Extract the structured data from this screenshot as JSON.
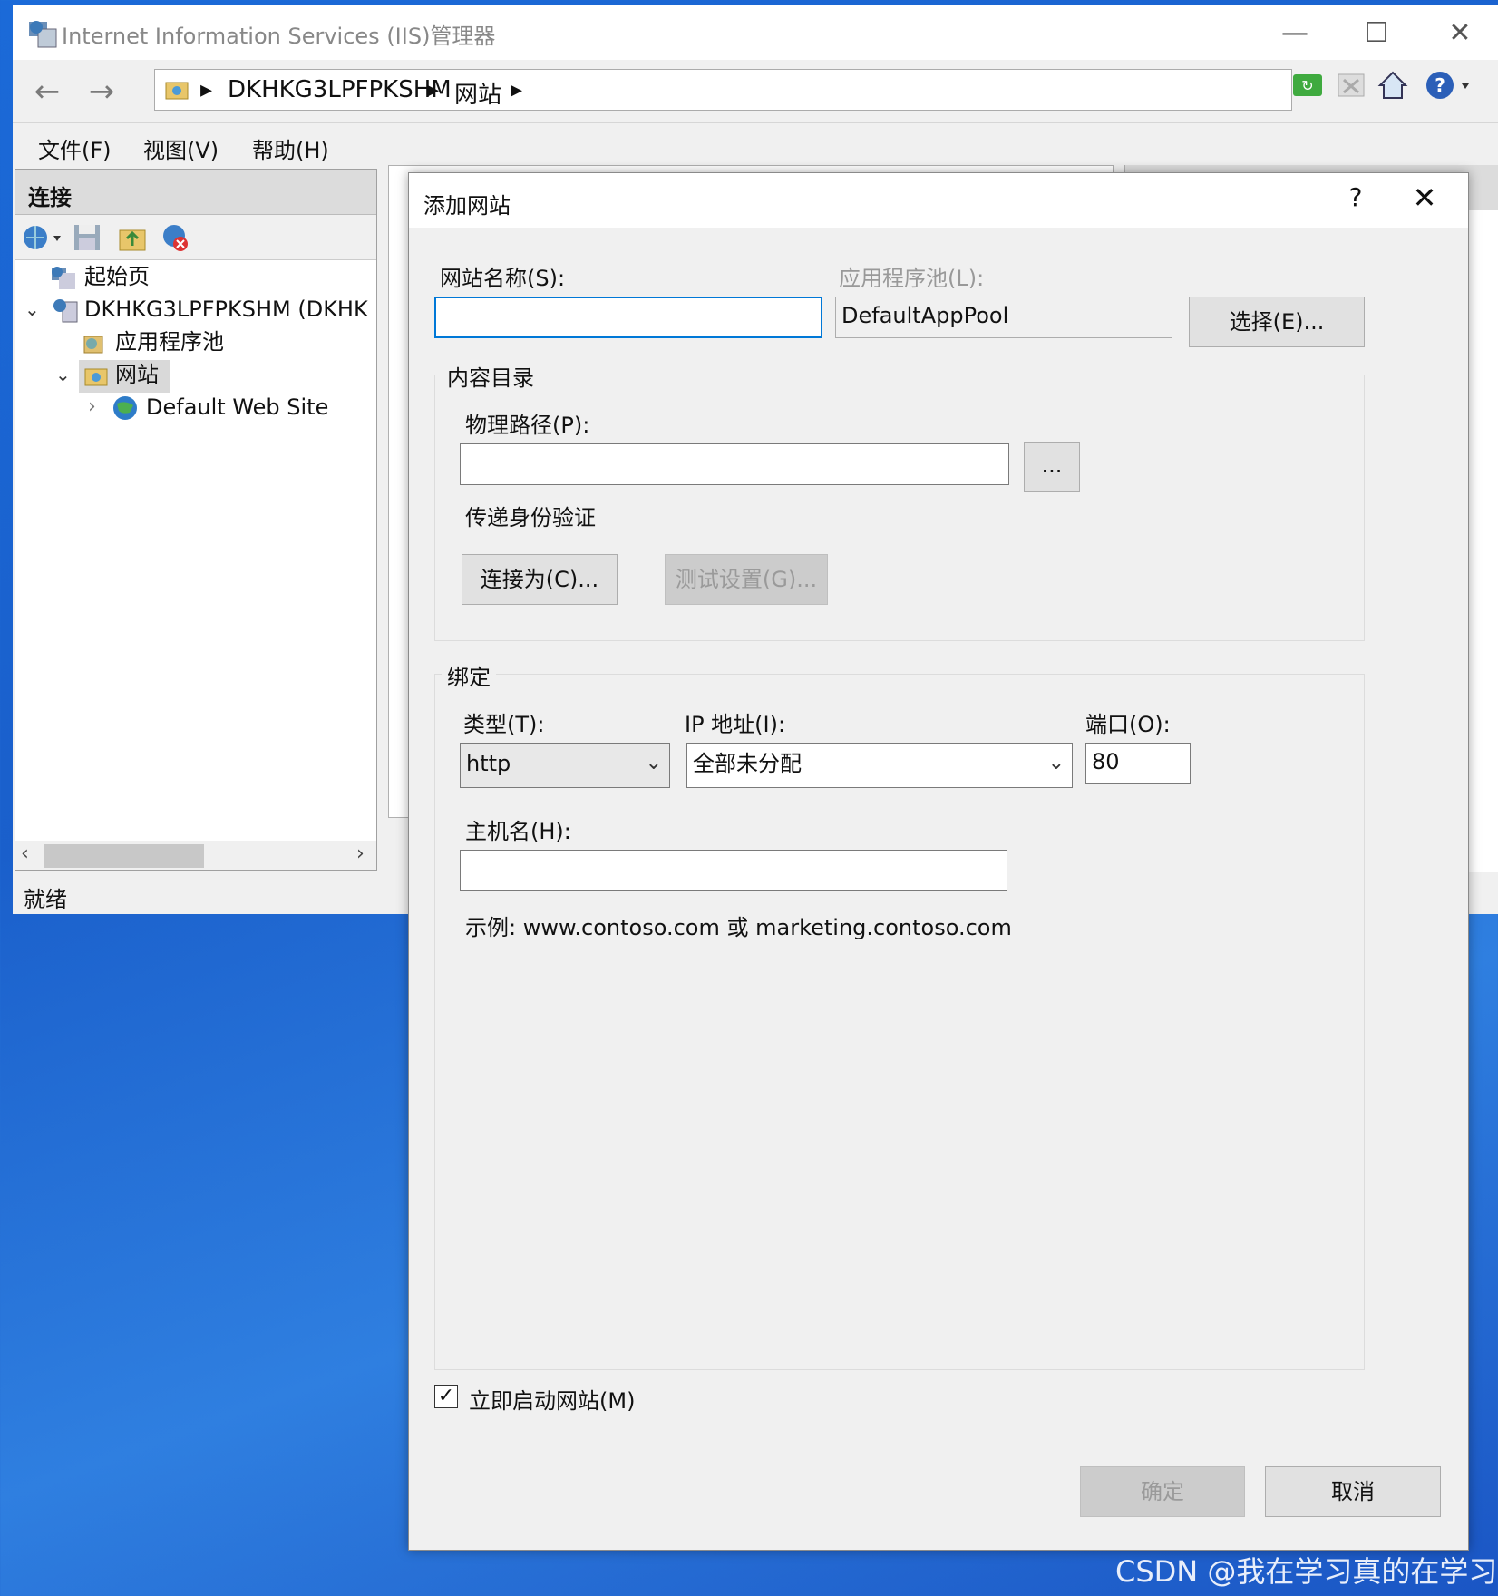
{
  "window": {
    "title": "Internet Information Services (IIS)管理器"
  },
  "nav": {
    "breadcrumb": [
      "DKHKG3LPFPKSHM",
      "网站"
    ]
  },
  "menu": {
    "items": [
      "文件(F)",
      "视图(V)",
      "帮助(H)"
    ]
  },
  "connections": {
    "title": "连接",
    "tree": [
      {
        "label": "起始页"
      },
      {
        "label": "DKHKG3LPFPKSHM (DKHK"
      },
      {
        "label": "应用程序池"
      },
      {
        "label": "网站"
      },
      {
        "label": "Default Web Site"
      }
    ]
  },
  "status": {
    "text": "就绪"
  },
  "dialog": {
    "title": "添加网站",
    "help": "?",
    "site_name_label": "网站名称(S):",
    "site_name_value": "",
    "app_pool_label": "应用程序池(L):",
    "app_pool_value": "DefaultAppPool",
    "select_button": "选择(E)...",
    "content_group": "内容目录",
    "physical_path_label": "物理路径(P):",
    "physical_path_value": "",
    "browse_button": "...",
    "pass_auth_label": "传递身份验证",
    "connect_as_button": "连接为(C)...",
    "test_settings_button": "测试设置(G)...",
    "binding_group": "绑定",
    "type_label": "类型(T):",
    "type_value": "http",
    "ip_label": "IP 地址(I):",
    "ip_value": "全部未分配",
    "port_label": "端口(O):",
    "port_value": "80",
    "host_label": "主机名(H):",
    "host_value": "",
    "example_text": "示例: www.contoso.com 或 marketing.contoso.com",
    "start_checkbox_label": "立即启动网站(M)",
    "start_checked": true,
    "ok_button": "确定",
    "cancel_button": "取消"
  },
  "watermark": "CSDN @我在学习真的在学习",
  "colors": {
    "desktop": "#1b6ad8",
    "window_bg": "#f0f0f0",
    "input_focus_border": "#0078d7"
  }
}
